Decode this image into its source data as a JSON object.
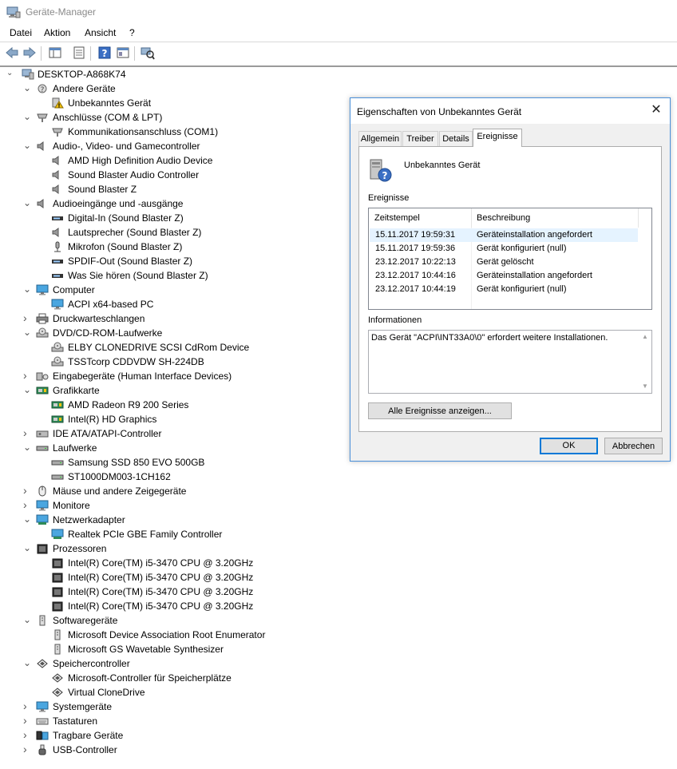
{
  "window": {
    "title": "Geräte-Manager",
    "icon": "device-manager-icon"
  },
  "menu": [
    "Datei",
    "Aktion",
    "Ansicht",
    "?"
  ],
  "toolbar": [
    "back-icon",
    "forward-icon",
    "show-hide-console-tree-icon",
    "properties-icon",
    "help-icon",
    "view-icon",
    "scan-hardware-icon"
  ],
  "tree": {
    "root": "DESKTOP-A868K74",
    "nodes": [
      {
        "label": "Andere Geräte",
        "level": 1,
        "expanded": true,
        "icon": "other-devices-icon"
      },
      {
        "label": "Unbekanntes Gerät",
        "level": 2,
        "icon": "warning-device-icon"
      },
      {
        "label": "Anschlüsse (COM & LPT)",
        "level": 1,
        "expanded": true,
        "icon": "port-icon"
      },
      {
        "label": "Kommunikationsanschluss (COM1)",
        "level": 2,
        "icon": "port-icon"
      },
      {
        "label": "Audio-, Video- und Gamecontroller",
        "level": 1,
        "expanded": true,
        "icon": "speaker-icon"
      },
      {
        "label": "AMD High Definition Audio Device",
        "level": 2,
        "icon": "speaker-icon"
      },
      {
        "label": "Sound Blaster Audio Controller",
        "level": 2,
        "icon": "speaker-icon"
      },
      {
        "label": "Sound Blaster Z",
        "level": 2,
        "icon": "speaker-icon"
      },
      {
        "label": "Audioeingänge und -ausgänge",
        "level": 1,
        "expanded": true,
        "icon": "speaker-icon"
      },
      {
        "label": "Digital-In (Sound Blaster Z)",
        "level": 2,
        "icon": "audio-jack-icon"
      },
      {
        "label": "Lautsprecher (Sound Blaster Z)",
        "level": 2,
        "icon": "speaker-icon"
      },
      {
        "label": "Mikrofon (Sound Blaster Z)",
        "level": 2,
        "icon": "microphone-icon"
      },
      {
        "label": "SPDIF-Out (Sound Blaster Z)",
        "level": 2,
        "icon": "audio-jack-icon"
      },
      {
        "label": "Was Sie hören (Sound Blaster Z)",
        "level": 2,
        "icon": "audio-jack-icon"
      },
      {
        "label": "Computer",
        "level": 1,
        "expanded": true,
        "icon": "monitor-icon"
      },
      {
        "label": "ACPI x64-based PC",
        "level": 2,
        "icon": "monitor-icon"
      },
      {
        "label": "Druckwarteschlangen",
        "level": 1,
        "expanded": false,
        "icon": "printer-icon"
      },
      {
        "label": "DVD/CD-ROM-Laufwerke",
        "level": 1,
        "expanded": true,
        "icon": "disc-drive-icon"
      },
      {
        "label": "ELBY CLONEDRIVE SCSI CdRom Device",
        "level": 2,
        "icon": "disc-drive-icon"
      },
      {
        "label": "TSSTcorp CDDVDW SH-224DB",
        "level": 2,
        "icon": "disc-drive-icon"
      },
      {
        "label": "Eingabegeräte (Human Interface Devices)",
        "level": 1,
        "expanded": false,
        "icon": "hid-icon"
      },
      {
        "label": "Grafikkarte",
        "level": 1,
        "expanded": true,
        "icon": "graphics-card-icon"
      },
      {
        "label": "AMD Radeon R9 200 Series",
        "level": 2,
        "icon": "graphics-card-icon"
      },
      {
        "label": "Intel(R) HD Graphics",
        "level": 2,
        "icon": "graphics-card-icon"
      },
      {
        "label": "IDE ATA/ATAPI-Controller",
        "level": 1,
        "expanded": false,
        "icon": "ide-controller-icon"
      },
      {
        "label": "Laufwerke",
        "level": 1,
        "expanded": true,
        "icon": "disk-drive-icon"
      },
      {
        "label": "Samsung SSD 850 EVO 500GB",
        "level": 2,
        "icon": "disk-drive-icon"
      },
      {
        "label": "ST1000DM003-1CH162",
        "level": 2,
        "icon": "disk-drive-icon"
      },
      {
        "label": "Mäuse und andere Zeigegeräte",
        "level": 1,
        "expanded": false,
        "icon": "mouse-icon"
      },
      {
        "label": "Monitore",
        "level": 1,
        "expanded": false,
        "icon": "monitor-icon"
      },
      {
        "label": "Netzwerkadapter",
        "level": 1,
        "expanded": true,
        "icon": "network-icon"
      },
      {
        "label": "Realtek PCIe GBE Family Controller",
        "level": 2,
        "icon": "network-icon"
      },
      {
        "label": "Prozessoren",
        "level": 1,
        "expanded": true,
        "icon": "cpu-icon"
      },
      {
        "label": "Intel(R) Core(TM) i5-3470 CPU @ 3.20GHz",
        "level": 2,
        "icon": "cpu-icon"
      },
      {
        "label": "Intel(R) Core(TM) i5-3470 CPU @ 3.20GHz",
        "level": 2,
        "icon": "cpu-icon"
      },
      {
        "label": "Intel(R) Core(TM) i5-3470 CPU @ 3.20GHz",
        "level": 2,
        "icon": "cpu-icon"
      },
      {
        "label": "Intel(R) Core(TM) i5-3470 CPU @ 3.20GHz",
        "level": 2,
        "icon": "cpu-icon"
      },
      {
        "label": "Softwaregeräte",
        "level": 1,
        "expanded": true,
        "icon": "software-device-icon"
      },
      {
        "label": "Microsoft Device Association Root Enumerator",
        "level": 2,
        "icon": "software-device-icon"
      },
      {
        "label": "Microsoft GS Wavetable Synthesizer",
        "level": 2,
        "icon": "software-device-icon"
      },
      {
        "label": "Speichercontroller",
        "level": 1,
        "expanded": true,
        "icon": "storage-controller-icon"
      },
      {
        "label": "Microsoft-Controller für Speicherplätze",
        "level": 2,
        "icon": "storage-controller-icon"
      },
      {
        "label": "Virtual CloneDrive",
        "level": 2,
        "icon": "storage-controller-icon"
      },
      {
        "label": "Systemgeräte",
        "level": 1,
        "expanded": false,
        "icon": "monitor-icon"
      },
      {
        "label": "Tastaturen",
        "level": 1,
        "expanded": false,
        "icon": "keyboard-icon"
      },
      {
        "label": "Tragbare Geräte",
        "level": 1,
        "expanded": false,
        "icon": "portable-device-icon"
      },
      {
        "label": "USB-Controller",
        "level": 1,
        "expanded": false,
        "icon": "usb-icon"
      }
    ]
  },
  "dialog": {
    "title": "Eigenschaften von Unbekanntes Gerät",
    "tabs": [
      "Allgemein",
      "Treiber",
      "Details",
      "Ereignisse"
    ],
    "active_tab": "Ereignisse",
    "device_name": "Unbekanntes Gerät",
    "events_label": "Ereignisse",
    "columns": [
      "Zeitstempel",
      "Beschreibung"
    ],
    "events": [
      {
        "time": "15.11.2017 19:59:31",
        "desc": "Geräteinstallation angefordert",
        "selected": true
      },
      {
        "time": "15.11.2017 19:59:36",
        "desc": "Gerät konfiguriert (null)"
      },
      {
        "time": "23.12.2017 10:22:13",
        "desc": "Gerät gelöscht"
      },
      {
        "time": "23.12.2017 10:44:16",
        "desc": "Geräteinstallation angefordert"
      },
      {
        "time": "23.12.2017 10:44:19",
        "desc": "Gerät konfiguriert (null)"
      }
    ],
    "info_label": "Informationen",
    "info_text": "Das Gerät \"ACPI\\INT33A0\\0\" erfordert weitere Installationen.",
    "show_all_button": "Alle Ereignisse anzeigen...",
    "ok_button": "OK",
    "cancel_button": "Abbrechen"
  },
  "colors": {
    "accent": "#0078d7",
    "selection": "#e5f3ff",
    "dialog_border": "#4a90d9"
  }
}
